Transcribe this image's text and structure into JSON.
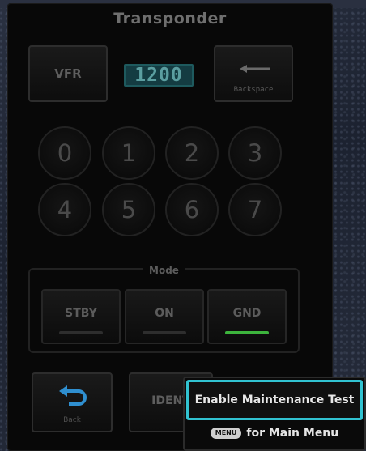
{
  "title": "Transponder",
  "vfr_label": "VFR",
  "squawk_code": "1200",
  "backspace_label": "Backspace",
  "keypad": [
    "0",
    "1",
    "2",
    "3",
    "4",
    "5",
    "6",
    "7"
  ],
  "mode": {
    "label": "Mode",
    "buttons": [
      {
        "label": "STBY",
        "active": false
      },
      {
        "label": "ON",
        "active": false
      },
      {
        "label": "GND",
        "active": true
      }
    ],
    "active_color": "#3db43d"
  },
  "back_label": "Back",
  "ident_label": "IDENT",
  "popup": {
    "selected": "Enable Maintenance Test",
    "menu_key": "MENU",
    "menu_text": "for Main Menu",
    "highlight_color": "#31c3d1"
  }
}
